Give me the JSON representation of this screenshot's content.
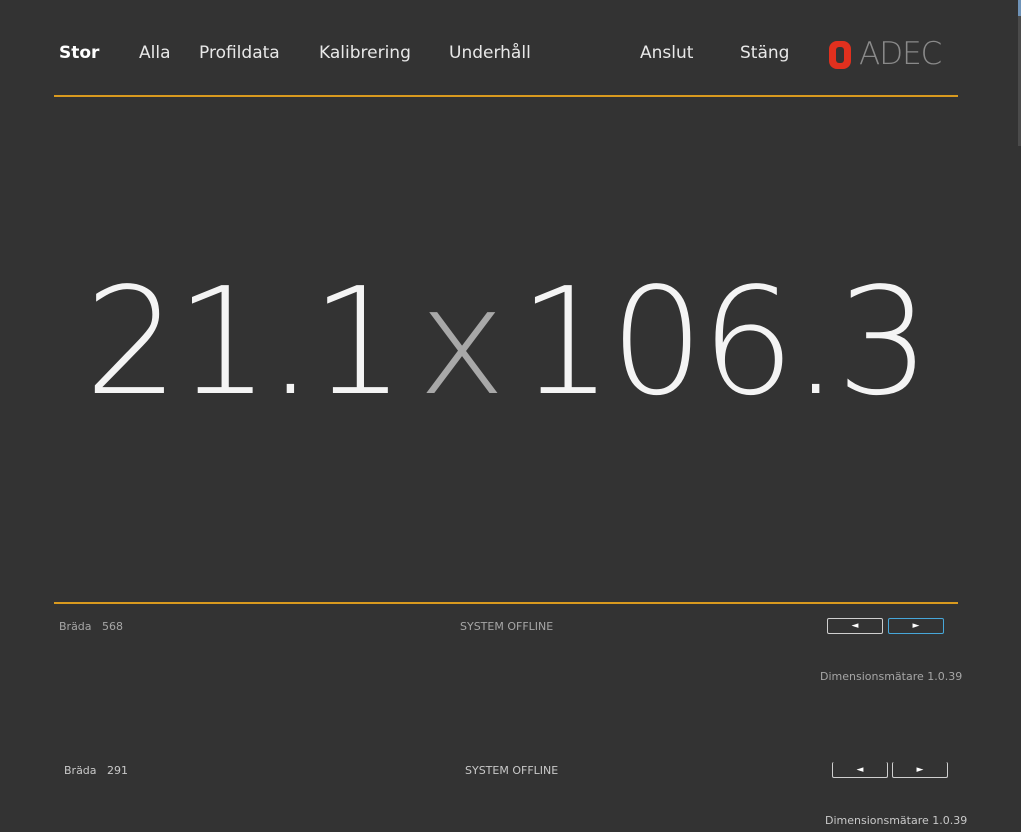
{
  "nav": {
    "stor": "Stor",
    "alla": "Alla",
    "profildata": "Profildata",
    "kalibrering": "Kalibrering",
    "underhall": "Underhåll",
    "anslut": "Anslut",
    "stang": "Stäng"
  },
  "brand": {
    "name": "ADEC",
    "mark_color": "#e0301e"
  },
  "colors": {
    "accent": "#d99a1f",
    "background": "#333333",
    "focus": "#47a7d9"
  },
  "measurement": {
    "thickness": "21.1",
    "separator": "x",
    "width": "106.3"
  },
  "status": {
    "board_label": "Bräda",
    "board_number": "568",
    "system_status": "SYSTEM OFFLINE",
    "prev_button": "◄",
    "next_button": "►",
    "version": "Dimensionsmätare 1.0.39"
  },
  "ghost": {
    "board_label": "Bräda",
    "board_number": "291",
    "system_status": "SYSTEM OFFLINE",
    "prev_button": "◄",
    "next_button": "►",
    "version": "Dimensionsmätare 1.0.39"
  }
}
